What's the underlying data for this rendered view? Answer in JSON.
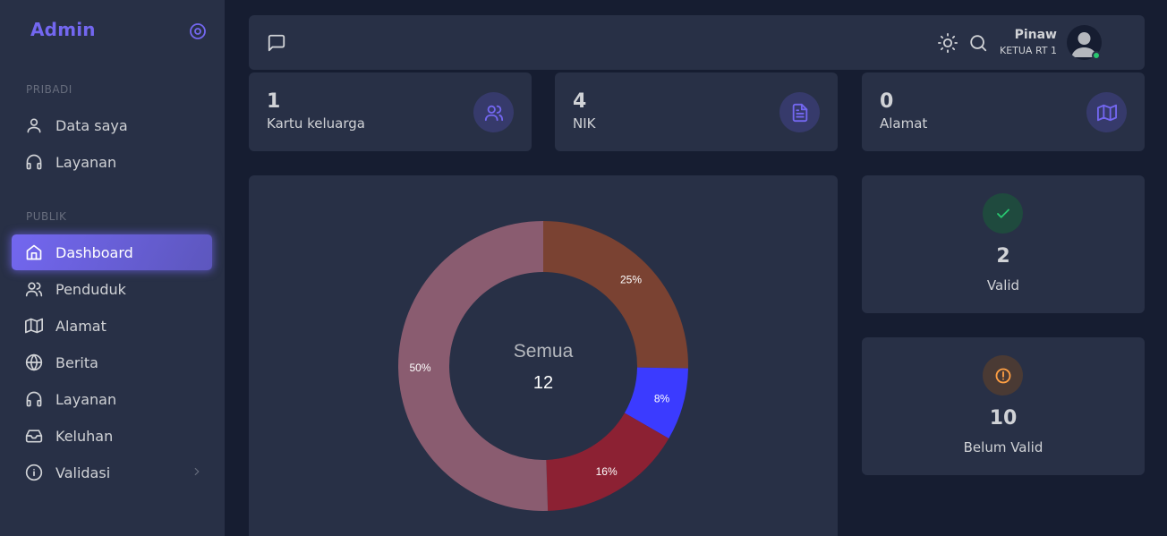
{
  "sidebar": {
    "brand": "Admin",
    "sections": {
      "pribadi": "PRIBADI",
      "publik": "PUBLIK"
    },
    "items": [
      {
        "label": "Data saya",
        "icon": "user-icon"
      },
      {
        "label": "Layanan",
        "icon": "headphones-icon"
      },
      {
        "label": "Dashboard",
        "icon": "home-icon",
        "active": true
      },
      {
        "label": "Penduduk",
        "icon": "users-icon"
      },
      {
        "label": "Alamat",
        "icon": "map-icon"
      },
      {
        "label": "Berita",
        "icon": "globe-icon"
      },
      {
        "label": "Layanan",
        "icon": "headphones-icon"
      },
      {
        "label": "Keluhan",
        "icon": "inbox-icon"
      },
      {
        "label": "Validasi",
        "icon": "info-icon"
      }
    ]
  },
  "header": {
    "user_name": "Pinaw",
    "user_role": "KETUA RT 1",
    "status_color": "#28c76f"
  },
  "stats": [
    {
      "value": "1",
      "label": "Kartu keluarga",
      "icon": "users-icon"
    },
    {
      "value": "4",
      "label": "NIK",
      "icon": "file-text-icon"
    },
    {
      "value": "0",
      "label": "Alamat",
      "icon": "map-icon"
    }
  ],
  "validity": {
    "valid": {
      "value": "2",
      "label": "Valid",
      "icon": "check-icon",
      "color": "#28c76f"
    },
    "invalid": {
      "value": "10",
      "label": "Belum Valid",
      "icon": "alert-circle-icon",
      "color": "#ff9f43"
    }
  },
  "chart_data": {
    "type": "pie",
    "donut": true,
    "center_label": "Semua",
    "center_value": "12",
    "slices": [
      {
        "percent": 25,
        "label": "25%",
        "color": "#7a4232"
      },
      {
        "percent": 8,
        "label": "8%",
        "color": "#3b3bff"
      },
      {
        "percent": 16,
        "label": "16%",
        "color": "#8c2133"
      },
      {
        "percent": 50,
        "label": "50%",
        "color": "#8a5c70"
      }
    ]
  },
  "accent": "#7367f0"
}
